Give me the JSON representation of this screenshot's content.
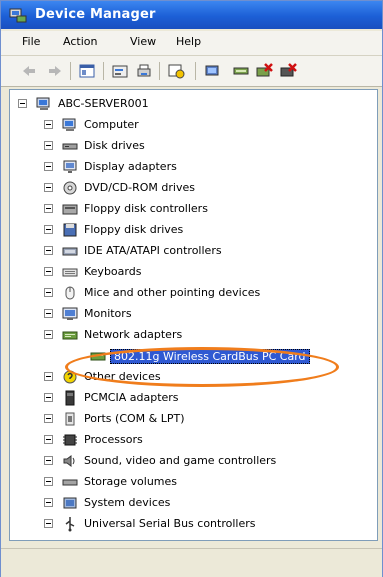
{
  "window": {
    "title": "Device Manager"
  },
  "menu": [
    "File",
    "Action",
    "View",
    "Help"
  ],
  "tree": {
    "root": "ABC-SERVER001",
    "items": [
      "Computer",
      "Disk drives",
      "Display adapters",
      "DVD/CD-ROM drives",
      "Floppy disk controllers",
      "Floppy disk drives",
      "IDE ATA/ATAPI controllers",
      "Keyboards",
      "Mice and other pointing devices",
      "Monitors",
      "Network adapters",
      "802.11g Wireless CardBus PC Card",
      "Other devices",
      "PCMCIA adapters",
      "Ports (COM & LPT)",
      "Processors",
      "Sound, video and game controllers",
      "Storage volumes",
      "System devices",
      "Universal Serial Bus controllers"
    ]
  },
  "colors": {
    "title_blue": "#1c5fd6",
    "highlight": "#f07d1c",
    "selection": "#2f59d2"
  }
}
